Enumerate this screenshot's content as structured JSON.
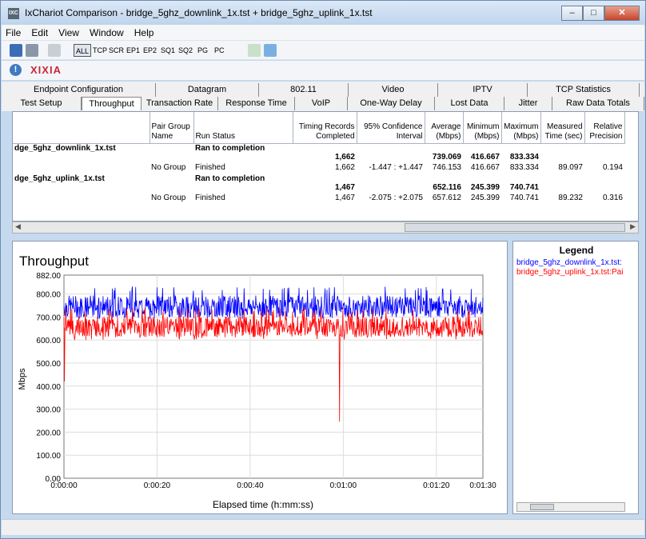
{
  "window": {
    "title": "IxChariot Comparison - bridge_5ghz_downlink_1x.tst + bridge_5ghz_uplink_1x.tst",
    "app_icon": "IXC"
  },
  "menu": [
    "File",
    "Edit",
    "View",
    "Window",
    "Help"
  ],
  "toolbar": {
    "filters": [
      "ALL",
      "TCP",
      "SCR",
      "EP1",
      "EP2",
      "SQ1",
      "SQ2",
      "PG",
      "PC"
    ]
  },
  "brand": {
    "logo": "XIXIA"
  },
  "tabs_row1": [
    "Endpoint Configuration",
    "Datagram",
    "802.11",
    "Video",
    "IPTV",
    "TCP Statistics"
  ],
  "tabs_row2": [
    "Test Setup",
    "Throughput",
    "Transaction Rate",
    "Response Time",
    "VoIP",
    "One-Way Delay",
    "Lost Data",
    "Jitter",
    "Raw Data Totals"
  ],
  "table": {
    "headers": [
      "",
      "Pair Group Name",
      "Run Status",
      "Timing Records Completed",
      "95% Confidence Interval",
      "Average (Mbps)",
      "Minimum (Mbps)",
      "Maximum (Mbps)",
      "Measured Time (sec)",
      "Relative Precision"
    ],
    "groups": [
      {
        "file": "dge_5ghz_downlink_1x.tst",
        "status": "Ran to completion",
        "summary": {
          "records": "1,662",
          "avg": "739.069",
          "min": "416.667",
          "max": "833.334"
        },
        "row": {
          "group": "No Group",
          "status": "Finished",
          "records": "1,662",
          "ci": "-1.447 : +1.447",
          "avg": "746.153",
          "min": "416.667",
          "max": "833.334",
          "time": "89.097",
          "prec": "0.194"
        }
      },
      {
        "file": "dge_5ghz_uplink_1x.tst",
        "status": "Ran to completion",
        "summary": {
          "records": "1,467",
          "avg": "652.116",
          "min": "245.399",
          "max": "740.741"
        },
        "row": {
          "group": "No Group",
          "status": "Finished",
          "records": "1,467",
          "ci": "-2.075 : +2.075",
          "avg": "657.612",
          "min": "245.399",
          "max": "740.741",
          "time": "89.232",
          "prec": "0.316"
        }
      }
    ]
  },
  "chart_data": {
    "type": "line",
    "title": "Throughput",
    "xlabel": "Elapsed time (h:mm:ss)",
    "ylabel": "Mbps",
    "ylim": [
      0,
      882
    ],
    "yticks": [
      "0.00",
      "100.00",
      "200.00",
      "300.00",
      "400.00",
      "500.00",
      "600.00",
      "700.00",
      "800.00",
      "882.00"
    ],
    "xticks": [
      "0:00:00",
      "0:00:20",
      "0:00:40",
      "0:01:00",
      "0:01:20",
      "0:01:30"
    ],
    "xlim_sec": [
      0,
      90
    ],
    "grid": true,
    "series": [
      {
        "name": "bridge_5ghz_downlink_1x.tst:",
        "color": "#0000ff",
        "mean": 746,
        "low": 690,
        "high": 833
      },
      {
        "name": "bridge_5ghz_uplink_1x.tst:Pai",
        "color": "#ff0000",
        "mean": 657,
        "low": 600,
        "high": 740,
        "dips": [
          {
            "x": 0.1,
            "y": 420
          },
          {
            "x": 59.2,
            "y": 245
          }
        ]
      }
    ]
  },
  "legend": {
    "title": "Legend"
  }
}
